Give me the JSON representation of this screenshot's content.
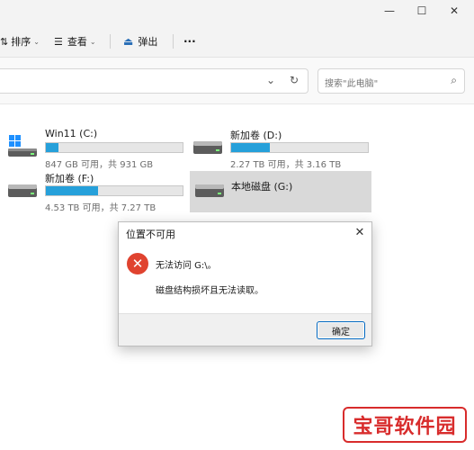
{
  "toolbar": {
    "sort_label": "排序",
    "view_label": "查看",
    "eject_label": "弹出",
    "more_label": "···"
  },
  "address_bar": {
    "dropdown_glyph": "⌄",
    "refresh_glyph": "↻"
  },
  "search": {
    "placeholder": "搜索\"此电脑\""
  },
  "drives": [
    {
      "name": "Win11 (C:)",
      "info": "847 GB 可用，共 931 GB",
      "used_fraction": 0.09,
      "icon": "windows-drive-icon"
    },
    {
      "name": "新加卷 (D:)",
      "info": "2.27 TB 可用，共 3.16 TB",
      "used_fraction": 0.28,
      "icon": "hard-drive-icon"
    },
    {
      "name": "新加卷 (F:)",
      "info": "4.53 TB 可用，共 7.27 TB",
      "used_fraction": 0.38,
      "icon": "hard-drive-icon"
    },
    {
      "name": "本地磁盘 (G:)",
      "info": "",
      "used_fraction": null,
      "icon": "hard-drive-icon"
    }
  ],
  "dialog": {
    "title": "位置不可用",
    "message_line1": "无法访问 G:\\。",
    "message_line2": "磁盘结构损坏且无法读取。",
    "ok_label": "确定"
  },
  "watermark": {
    "text": "宝哥软件园"
  },
  "colors": {
    "accent": "#0067c0",
    "usage_bar": "#26a0da",
    "error_icon": "#e0432f",
    "watermark": "#d82c2c"
  }
}
